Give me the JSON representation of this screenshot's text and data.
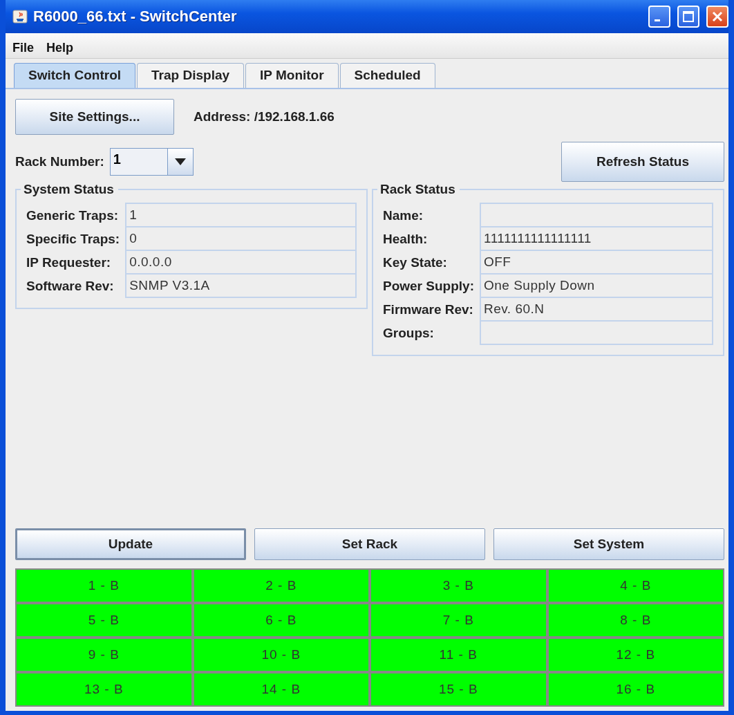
{
  "window": {
    "title": "R6000_66.txt - SwitchCenter"
  },
  "menu": [
    "File",
    "Help"
  ],
  "tabs": [
    {
      "label": "Switch Control",
      "selected": true
    },
    {
      "label": "Trap Display",
      "selected": false
    },
    {
      "label": "IP Monitor",
      "selected": false
    },
    {
      "label": "Scheduled",
      "selected": false
    }
  ],
  "site_settings_button": "Site Settings...",
  "address": "Address: /192.168.1.66",
  "rack_number": {
    "label": "Rack Number:",
    "value": "1"
  },
  "refresh_button": "Refresh Status",
  "system_status": {
    "title": "System Status",
    "fields": [
      {
        "label": "Generic Traps:",
        "value": "1"
      },
      {
        "label": "Specific Traps:",
        "value": "0"
      },
      {
        "label": "IP Requester:",
        "value": "0.0.0.0"
      },
      {
        "label": "Software Rev:",
        "value": "SNMP V3.1A"
      }
    ]
  },
  "rack_status": {
    "title": "Rack Status",
    "fields": [
      {
        "label": "Name:"
      },
      {
        "label": "Health:",
        "value": "1111111111111111"
      },
      {
        "label": "Key State:",
        "value": "OFF"
      },
      {
        "label": "Power Supply:",
        "value": "One Supply Down"
      },
      {
        "label": "Firmware Rev:",
        "value": "Rev. 60.N"
      },
      {
        "label": "Groups:"
      }
    ]
  },
  "buttons": [
    {
      "label": "Update",
      "selected": true
    },
    {
      "label": "Set Rack",
      "selected": false
    },
    {
      "label": "Set System",
      "selected": false
    }
  ],
  "switches": [
    {
      "label": "1 - B",
      "color": "#00ff00"
    },
    {
      "label": "2 - B",
      "color": "#00ff00"
    },
    {
      "label": "3 - B",
      "color": "#00ff00"
    },
    {
      "label": "4 - B",
      "color": "#00ff00"
    },
    {
      "label": "5 - B",
      "color": "#00ff00"
    },
    {
      "label": "6 - B",
      "color": "#00ff00"
    },
    {
      "label": "7 - B",
      "color": "#00ff00"
    },
    {
      "label": "8 - B",
      "color": "#00ff00"
    },
    {
      "label": "9 - B",
      "color": "#00ff00"
    },
    {
      "label": "10 - B",
      "color": "#00ff00"
    },
    {
      "label": "11 - B",
      "color": "#00ff00"
    },
    {
      "label": "12 - B",
      "color": "#00ff00"
    },
    {
      "label": "13 - B",
      "color": "#00ff00"
    },
    {
      "label": "14 - B",
      "color": "#00ff00"
    },
    {
      "label": "15 - B",
      "color": "#00ff00"
    },
    {
      "label": "16 - B",
      "color": "#00ff00"
    }
  ]
}
